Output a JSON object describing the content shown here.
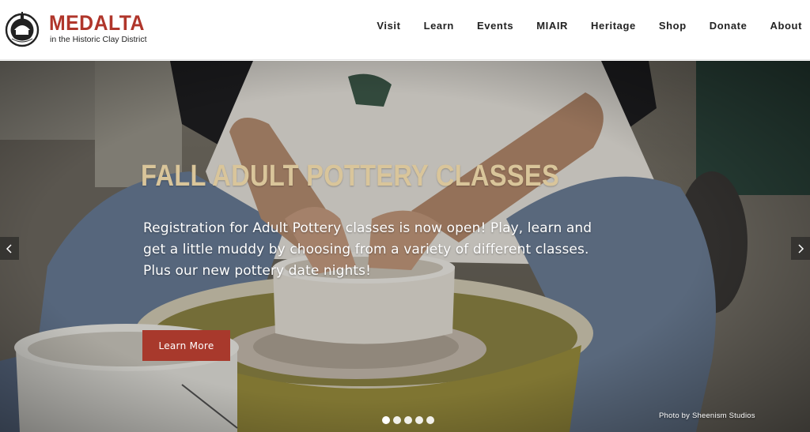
{
  "brand": {
    "name": "MEDALTA",
    "tagline": "in the Historic Clay District",
    "colors": {
      "accent": "#b0362b",
      "title_gold": "#d9c59a",
      "button": "#a8392c"
    }
  },
  "nav": {
    "items": [
      {
        "label": "Visit"
      },
      {
        "label": "Learn"
      },
      {
        "label": "Events"
      },
      {
        "label": "MIAIR"
      },
      {
        "label": "Heritage"
      },
      {
        "label": "Shop"
      },
      {
        "label": "Donate"
      },
      {
        "label": "About"
      }
    ]
  },
  "hero": {
    "title": "FALL ADULT POTTERY CLASSES",
    "text": "Registration for Adult Pottery classes is now open! Play, learn and get a little muddy by choosing from a variety of different classes. Plus our new pottery date nights!",
    "button_label": "Learn More",
    "credit": "Photo by Sheenism Studios",
    "slide_count": 5,
    "active_slide": 1,
    "prev_icon": "chevron-left-icon",
    "next_icon": "chevron-right-icon"
  }
}
